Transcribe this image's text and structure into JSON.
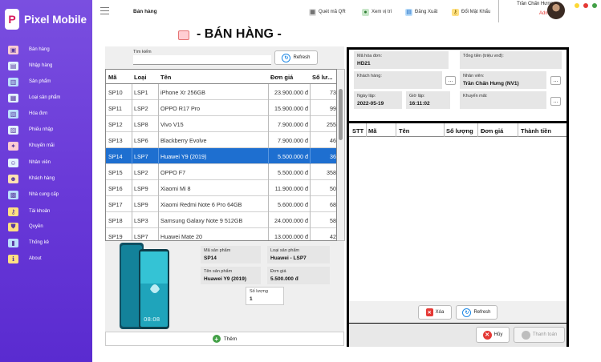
{
  "app": {
    "name": "Pixel Mobile",
    "logo_letter": "P"
  },
  "sidebar": {
    "items": [
      {
        "label": "Bán hàng",
        "icon": "store-icon",
        "color": "#ffcdd2"
      },
      {
        "label": "Nhập hàng",
        "icon": "warehouse-icon",
        "color": "#e3f2fd"
      },
      {
        "label": "Sản phẩm",
        "icon": "product-icon",
        "color": "#bbdefb"
      },
      {
        "label": "Loại sản phẩm",
        "icon": "category-icon",
        "color": "#e3f2fd"
      },
      {
        "label": "Hóa đơn",
        "icon": "invoice-icon",
        "color": "#bbdefb"
      },
      {
        "label": "Phiếu nhập",
        "icon": "receipt-icon",
        "color": "#e3f2fd"
      },
      {
        "label": "Khuyến mãi",
        "icon": "gift-icon",
        "color": "#ffcdd2"
      },
      {
        "label": "Nhân viên",
        "icon": "staff-icon",
        "color": "#e3f2fd"
      },
      {
        "label": "Khách hàng",
        "icon": "customer-icon",
        "color": "#ffe0b2"
      },
      {
        "label": "Nhà cung cấp",
        "icon": "supplier-icon",
        "color": "#bbdefb"
      },
      {
        "label": "Tài khoản",
        "icon": "key-icon",
        "color": "#ffe082"
      },
      {
        "label": "Quyền",
        "icon": "shield-icon",
        "color": "#ffe082"
      },
      {
        "label": "Thống kê",
        "icon": "chart-icon",
        "color": "#bbdefb"
      },
      {
        "label": "About",
        "icon": "info-icon",
        "color": "#ffe082"
      }
    ]
  },
  "topbar": {
    "breadcrumb": "Bán hàng",
    "actions": [
      {
        "label": "Quét mã QR",
        "icon": "qr-icon"
      },
      {
        "label": "Xem vị trí",
        "icon": "location-icon"
      },
      {
        "label": "Đăng Xuất",
        "icon": "logout-icon"
      },
      {
        "label": "Đổi Mật Khẩu",
        "icon": "key-icon"
      }
    ],
    "user": {
      "name": "Trần Chấn Hưng",
      "role": "Admin"
    },
    "window_dots": [
      "#fdd835",
      "#e53935",
      "#43a047"
    ]
  },
  "page": {
    "title": "- BÁN HÀNG -"
  },
  "search": {
    "label": "Tìm kiếm",
    "value": "",
    "refresh_label": "Refresh"
  },
  "product_table": {
    "headers": [
      "Mã",
      "Loại",
      "Tên",
      "Đơn giá",
      "Số lư..."
    ],
    "rows": [
      {
        "ma": "SP10",
        "loai": "LSP1",
        "ten": "iPhone Xr 256GB",
        "gia": "23.900.000 đ",
        "sl": "73"
      },
      {
        "ma": "SP11",
        "loai": "LSP2",
        "ten": "OPPO R17 Pro",
        "gia": "15.900.000 đ",
        "sl": "99"
      },
      {
        "ma": "SP12",
        "loai": "LSP8",
        "ten": "Vivo V15",
        "gia": "7.900.000 đ",
        "sl": "255"
      },
      {
        "ma": "SP13",
        "loai": "LSP6",
        "ten": "Blackberry Evolve",
        "gia": "7.900.000 đ",
        "sl": "46"
      },
      {
        "ma": "SP14",
        "loai": "LSP7",
        "ten": "Huawei Y9 (2019)",
        "gia": "5.500.000 đ",
        "sl": "36",
        "selected": true
      },
      {
        "ma": "SP15",
        "loai": "LSP2",
        "ten": "OPPO F7",
        "gia": "5.500.000 đ",
        "sl": "358"
      },
      {
        "ma": "SP16",
        "loai": "LSP9",
        "ten": "Xiaomi Mi 8",
        "gia": "11.900.000 đ",
        "sl": "50"
      },
      {
        "ma": "SP17",
        "loai": "LSP9",
        "ten": "Xiaomi Redmi Note 6 Pro 64GB",
        "gia": "5.600.000 đ",
        "sl": "68"
      },
      {
        "ma": "SP18",
        "loai": "LSP3",
        "ten": "Samsung Galaxy Note 9 512GB",
        "gia": "24.000.000 đ",
        "sl": "58"
      },
      {
        "ma": "SP19",
        "loai": "LSP7",
        "ten": "Huawei Mate 20",
        "gia": "13.000.000 đ",
        "sl": "42"
      }
    ]
  },
  "detail": {
    "ma_sp_label": "Mã sản phẩm",
    "ma_sp": "SP14",
    "loai_sp_label": "Loại sản phẩm",
    "loai_sp": "Huawei - LSP7",
    "ten_sp_label": "Tên sản phẩm",
    "ten_sp": "Huawei Y9 (2019)",
    "gia_label": "Đơn giá",
    "gia": "5.500.000 đ",
    "sl_label": "Số lượng",
    "sl": "1",
    "add_label": "Thêm"
  },
  "invoice": {
    "ma_hd_label": "Mã hóa đơn:",
    "ma_hd": "HD21",
    "tong_label": "Tổng tiền (triệu vnđ):",
    "tong": "",
    "khach_label": "Khách hàng:",
    "khach": "",
    "nv_label": "Nhân viên:",
    "nv": "Trần Chấn Hưng (NV1)",
    "ngay_label": "Ngày lập:",
    "ngay": "2022-05-19",
    "gio_label": "Giờ lập:",
    "gio": "16:11:02",
    "km_label": "Khuyến mãi:",
    "km": "",
    "dots": "..."
  },
  "cart": {
    "headers": [
      "STT",
      "Mã",
      "Tên",
      "Số lượng",
      "Đơn giá",
      "Thành tiền"
    ],
    "delete_label": "Xóa",
    "refresh_label": "Refresh"
  },
  "footer": {
    "cancel_label": "Hủy",
    "pay_label": "Thanh toán"
  }
}
